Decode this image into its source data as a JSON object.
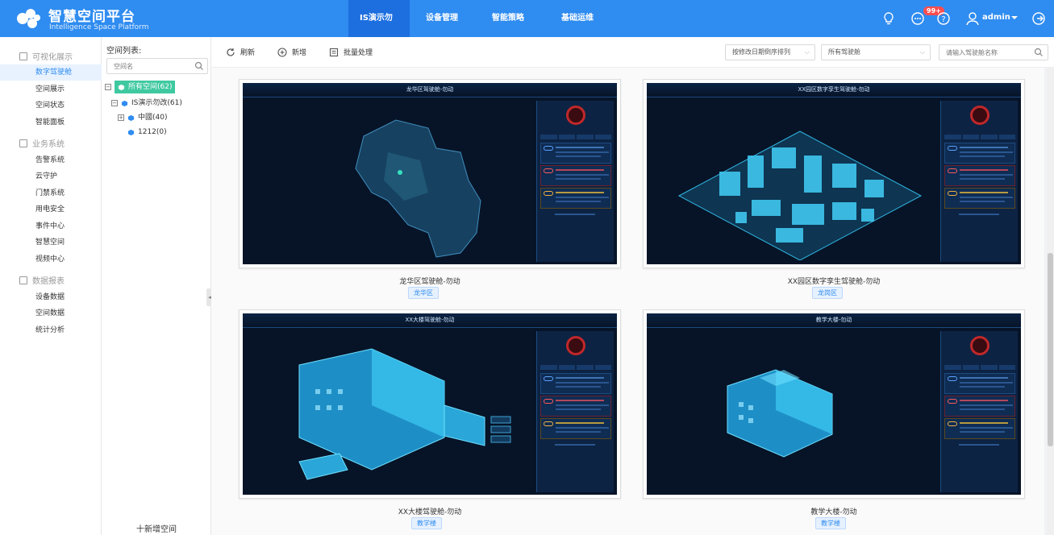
{
  "app": {
    "title": "智慧空间平台",
    "subtitle": "Intelligence Space Platform"
  },
  "topnav": {
    "tabs": [
      {
        "label": "IS演示勿改",
        "active": true
      },
      {
        "label": "设备管理",
        "active": false
      },
      {
        "label": "智能策略",
        "active": false
      },
      {
        "label": "基础运维",
        "active": false
      }
    ]
  },
  "header_tools": {
    "notification_badge": "99+",
    "user": "admin",
    "icons": [
      "bulb-icon",
      "message-icon",
      "help-icon",
      "user-icon",
      "chevron-down-icon",
      "logout-icon"
    ]
  },
  "sidebar": {
    "groups": [
      {
        "label": "可视化展示",
        "icon": "grid-icon",
        "items": [
          {
            "label": "数字驾驶舱",
            "active": true
          },
          {
            "label": "空间展示",
            "active": false
          },
          {
            "label": "空间状态",
            "active": false
          },
          {
            "label": "智能面板",
            "active": false
          }
        ]
      },
      {
        "label": "业务系统",
        "icon": "app-icon",
        "items": [
          {
            "label": "告警系统",
            "active": false
          },
          {
            "label": "云守护",
            "active": false
          },
          {
            "label": "门禁系统",
            "active": false
          },
          {
            "label": "用电安全",
            "active": false
          },
          {
            "label": "事件中心",
            "active": false
          },
          {
            "label": "智慧空间",
            "active": false
          },
          {
            "label": "视频中心",
            "active": false
          }
        ]
      },
      {
        "label": "数据报表",
        "icon": "chart-icon",
        "items": [
          {
            "label": "设备数据",
            "active": false
          },
          {
            "label": "空间数据",
            "active": false
          },
          {
            "label": "统计分析",
            "active": false
          }
        ]
      }
    ]
  },
  "tree": {
    "title": "空间列表:",
    "search_placeholder": "空间名",
    "nodes": [
      {
        "label": "所有空间(62)",
        "selected": true
      },
      {
        "label": "IS演示勿改(61)",
        "selected": false
      },
      {
        "label": "中國(40)",
        "selected": false
      },
      {
        "label": "1212(0)",
        "selected": false
      }
    ],
    "add_label": "十新增空间"
  },
  "toolbar": {
    "refresh_label": "刷新",
    "add_label": "新增",
    "batch_label": "批量处理",
    "sort_select": "按修改日期倒序排列",
    "cockpit_select": "所有驾驶舱",
    "search_placeholder": "请输入驾驶舱名称"
  },
  "cards": [
    {
      "title": "龙华区驾驶舱-勿动",
      "tag": "龙华区",
      "screen_title": "龙华区驾驶舱-勿动",
      "kind": "map"
    },
    {
      "title": "XX园区数字孪生驾驶舱-勿动",
      "tag": "龙岗区",
      "screen_title": "XX园区数字孪生驾驶舱-勿动",
      "kind": "campus"
    },
    {
      "title": "XX大楼驾驶舱-勿动",
      "tag": "教学楼",
      "screen_title": "XX大楼驾驶舱-勿动",
      "kind": "building"
    },
    {
      "title": "教学大楼-勿动",
      "tag": "教学楼",
      "screen_title": "教学大楼-勿动",
      "kind": "small-building"
    }
  ],
  "colors": {
    "primary": "#2f8cf0",
    "active_tab": "#1d6fe0",
    "tree_selected": "#3fc9a0",
    "screen_bg": "#071428",
    "alarm": "#c0282a"
  }
}
